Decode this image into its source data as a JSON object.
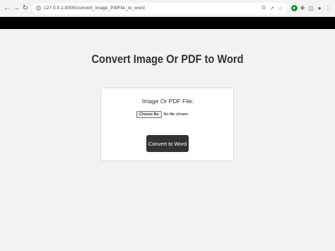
{
  "browser": {
    "url": "127.0.0.1:8000/convert_image_PdfFile_to_word"
  },
  "page": {
    "title": "Convert Image Or PDF to Word"
  },
  "form": {
    "field_label": "Image Or PDF File:",
    "choose_file_label": "Choose file",
    "no_file_text": "No file chosen",
    "submit_label": "Convert to Word"
  },
  "colors": {
    "header_bg": "#000000",
    "button_bg": "#333333",
    "page_bg": "#f2f2f2"
  }
}
